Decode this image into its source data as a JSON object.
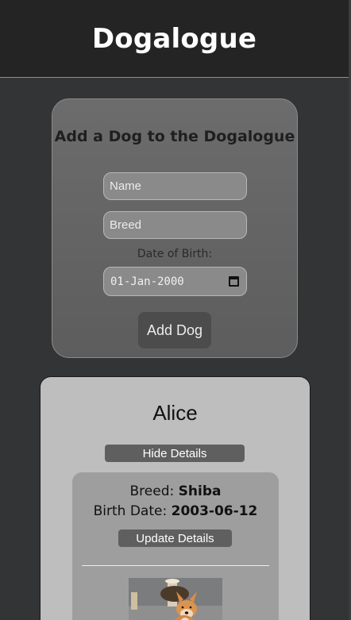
{
  "header": {
    "title": "Dogalogue"
  },
  "form": {
    "title": "Add a Dog to the Dogalogue",
    "name_placeholder": "Name",
    "breed_placeholder": "Breed",
    "dob_label": "Date of Birth:",
    "dob_value": "01-Jan-2000",
    "submit_label": "Add Dog"
  },
  "dog": {
    "name": "Alice",
    "hide_label": "Hide Details",
    "breed_label": "Breed: ",
    "breed_value": "Shiba",
    "birth_label": "Birth Date: ",
    "birth_value": "2003-06-12",
    "update_label": "Update Details",
    "photo_icon": "shiba-inu-dog-photo"
  }
}
